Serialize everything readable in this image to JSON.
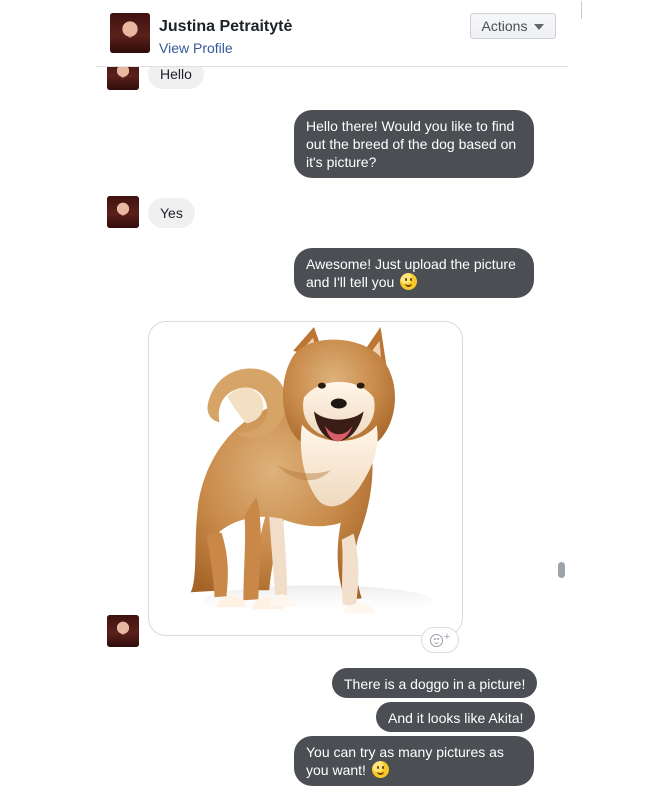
{
  "header": {
    "name": "Justina Petraitytė",
    "view_profile": "View Profile",
    "actions_label": "Actions",
    "avatar_icon": "profile-photo-avatar"
  },
  "messages": [
    {
      "side": "incoming",
      "text": "Hello"
    },
    {
      "side": "outgoing",
      "text": "Hello there! Would you like to find out the breed of the dog based on it's picture?"
    },
    {
      "side": "incoming",
      "text": "Yes"
    },
    {
      "side": "outgoing",
      "text": "Awesome! Just upload the picture and I'll tell you",
      "emoji": "smile-icon"
    },
    {
      "side": "incoming",
      "image": "shiba-inu-dog-image"
    },
    {
      "side": "outgoing",
      "text": "There is a doggo in a picture!"
    },
    {
      "side": "outgoing",
      "text": "And it looks like Akita!"
    },
    {
      "side": "outgoing",
      "text": "You can try as many pictures as you want!",
      "emoji": "smile-icon"
    }
  ],
  "icons": {
    "caret": "chevron-down-icon",
    "reaction": "reaction-face-icon",
    "reaction_add": "plus-icon",
    "emoji": "smile-icon"
  },
  "colors": {
    "outgoing_bubble": "#4b4e53",
    "incoming_bubble": "#f1f0f0",
    "link": "#365899",
    "header_border": "#dddfe2"
  }
}
